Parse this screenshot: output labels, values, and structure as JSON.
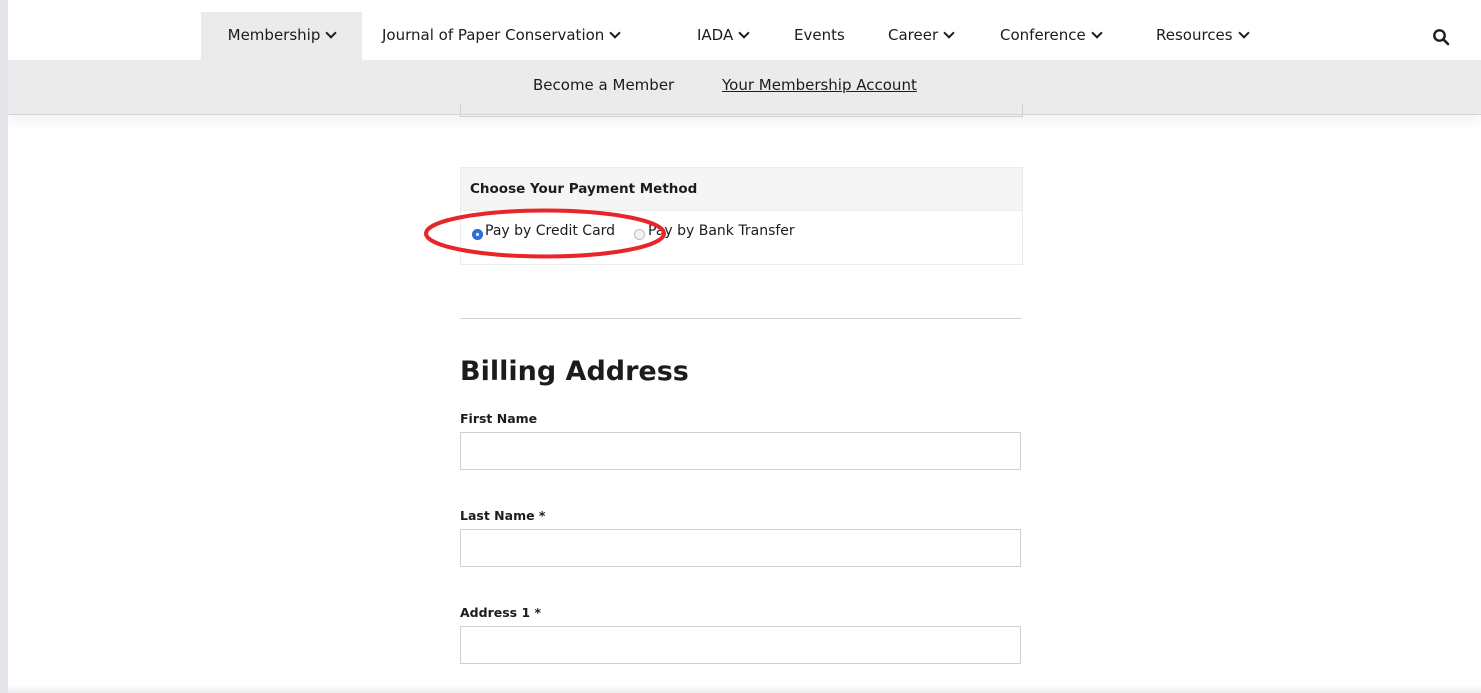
{
  "nav": {
    "items": [
      {
        "label": "Membership",
        "dropdown": true,
        "active": true
      },
      {
        "label": "Journal of Paper Conservation",
        "dropdown": true
      },
      {
        "label": "IADA",
        "dropdown": true
      },
      {
        "label": "Events",
        "dropdown": false
      },
      {
        "label": "Career",
        "dropdown": true
      },
      {
        "label": "Conference",
        "dropdown": true
      },
      {
        "label": "Resources",
        "dropdown": true
      }
    ],
    "search_icon": "search-icon"
  },
  "subnav": {
    "become_member": "Become a Member",
    "account": "Your Membership Account"
  },
  "payment": {
    "heading": "Choose Your Payment Method",
    "options": [
      {
        "label": "Pay by Credit Card",
        "selected": true
      },
      {
        "label": "Pay by Bank Transfer",
        "selected": false
      }
    ],
    "annotation_color": "#e8262a"
  },
  "billing": {
    "title": "Billing Address",
    "fields": [
      {
        "label": "First Name",
        "value": ""
      },
      {
        "label": "Last Name *",
        "value": ""
      },
      {
        "label": "Address 1 *",
        "value": ""
      }
    ]
  },
  "colors": {
    "accent_radio": "#2f6fe0",
    "nav_active_bg": "#ebebeb",
    "text": "#1c1c1c"
  }
}
